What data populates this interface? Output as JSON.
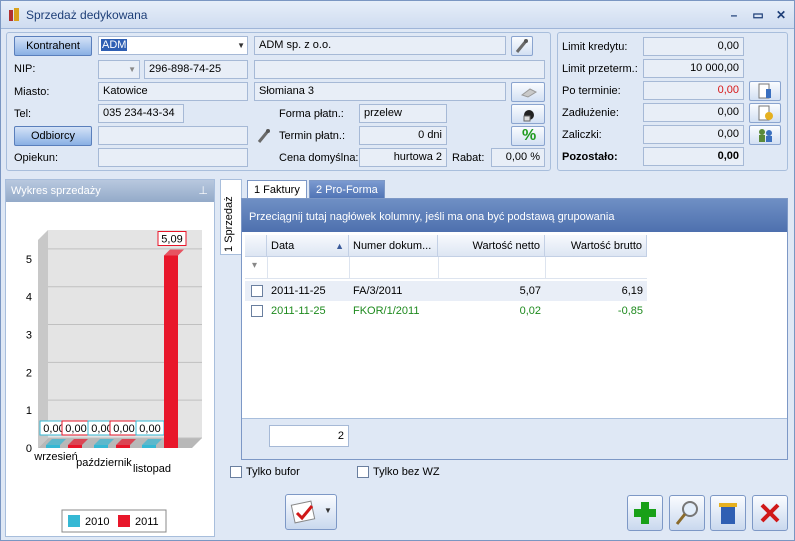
{
  "window": {
    "title": "Sprzedaż dedykowana"
  },
  "contractor": {
    "kontrahent_btn": "Kontrahent",
    "kontrahent_code": "ADM",
    "kontrahent_name": "ADM sp. z o.o.",
    "nip_label": "NIP:",
    "nip": "296-898-74-25",
    "miasto_label": "Miasto:",
    "miasto": "Katowice",
    "adres": "Słomiana 3",
    "tel_label": "Tel:",
    "tel": "035 234-43-34",
    "forma_label": "Forma  płatn.:",
    "forma": "przelew",
    "odbiorcy_btn": "Odbiorcy",
    "termin_label": "Termin płatn.:",
    "termin": "0 dni",
    "opiekun_label": "Opiekun:",
    "cena_label": "Cena domyślna:",
    "cena": "hurtowa 2",
    "rabat_label": "Rabat:",
    "rabat": "0,00 %"
  },
  "credit": {
    "limit_kredytu_label": "Limit kredytu:",
    "limit_kredytu": "0,00",
    "limit_przeterm_label": "Limit przeterm.:",
    "limit_przeterm": "10 000,00",
    "po_terminie_label": "Po terminie:",
    "po_terminie": "0,00",
    "zadluzenie_label": "Zadłużenie:",
    "zadluzenie": "0,00",
    "zaliczki_label": "Zaliczki:",
    "zaliczki": "0,00",
    "pozostalo_label": "Pozostało:",
    "pozostalo": "0,00"
  },
  "chart_panel": {
    "title": "Wykres sprzedaży"
  },
  "chart_data": {
    "type": "bar",
    "categories": [
      "wrzesień",
      "październik",
      "listopad"
    ],
    "series": [
      {
        "name": "2010",
        "values": [
          0.0,
          0.0,
          0.0
        ],
        "labels": [
          "0,00",
          "0,00",
          "0,00"
        ],
        "color": "#35b8d4"
      },
      {
        "name": "2011",
        "values": [
          0.0,
          0.0,
          5.09
        ],
        "labels": [
          "0,00",
          "0,00",
          "5,09"
        ],
        "color": "#e8162a"
      }
    ],
    "yticks": [
      "0",
      "1",
      "2",
      "3",
      "4",
      "5"
    ],
    "ylim": [
      0,
      5.5
    ]
  },
  "tabs": {
    "side": "1 Sprzedaż",
    "faktury": "1 Faktury",
    "proforma": "2 Pro-Forma"
  },
  "grid": {
    "group_hint": "Przeciągnij tutaj nagłówek kolumny, jeśli ma ona być podstawą grupowania",
    "headers": [
      "Data",
      "Numer dokum...",
      "Wartość netto",
      "Wartość brutto"
    ],
    "rows": [
      {
        "data": "2011-11-25",
        "numer": "FA/3/2011",
        "netto": "5,07",
        "brutto": "6,19",
        "color": "#000000"
      },
      {
        "data": "2011-11-25",
        "numer": "FKOR/1/2011",
        "netto": "0,02",
        "brutto": "-0,85",
        "color": "#1e8a1e"
      }
    ],
    "count": "2"
  },
  "options": {
    "tylko_bufor": "Tylko bufor",
    "tylko_bez_wz": "Tylko bez WZ"
  }
}
